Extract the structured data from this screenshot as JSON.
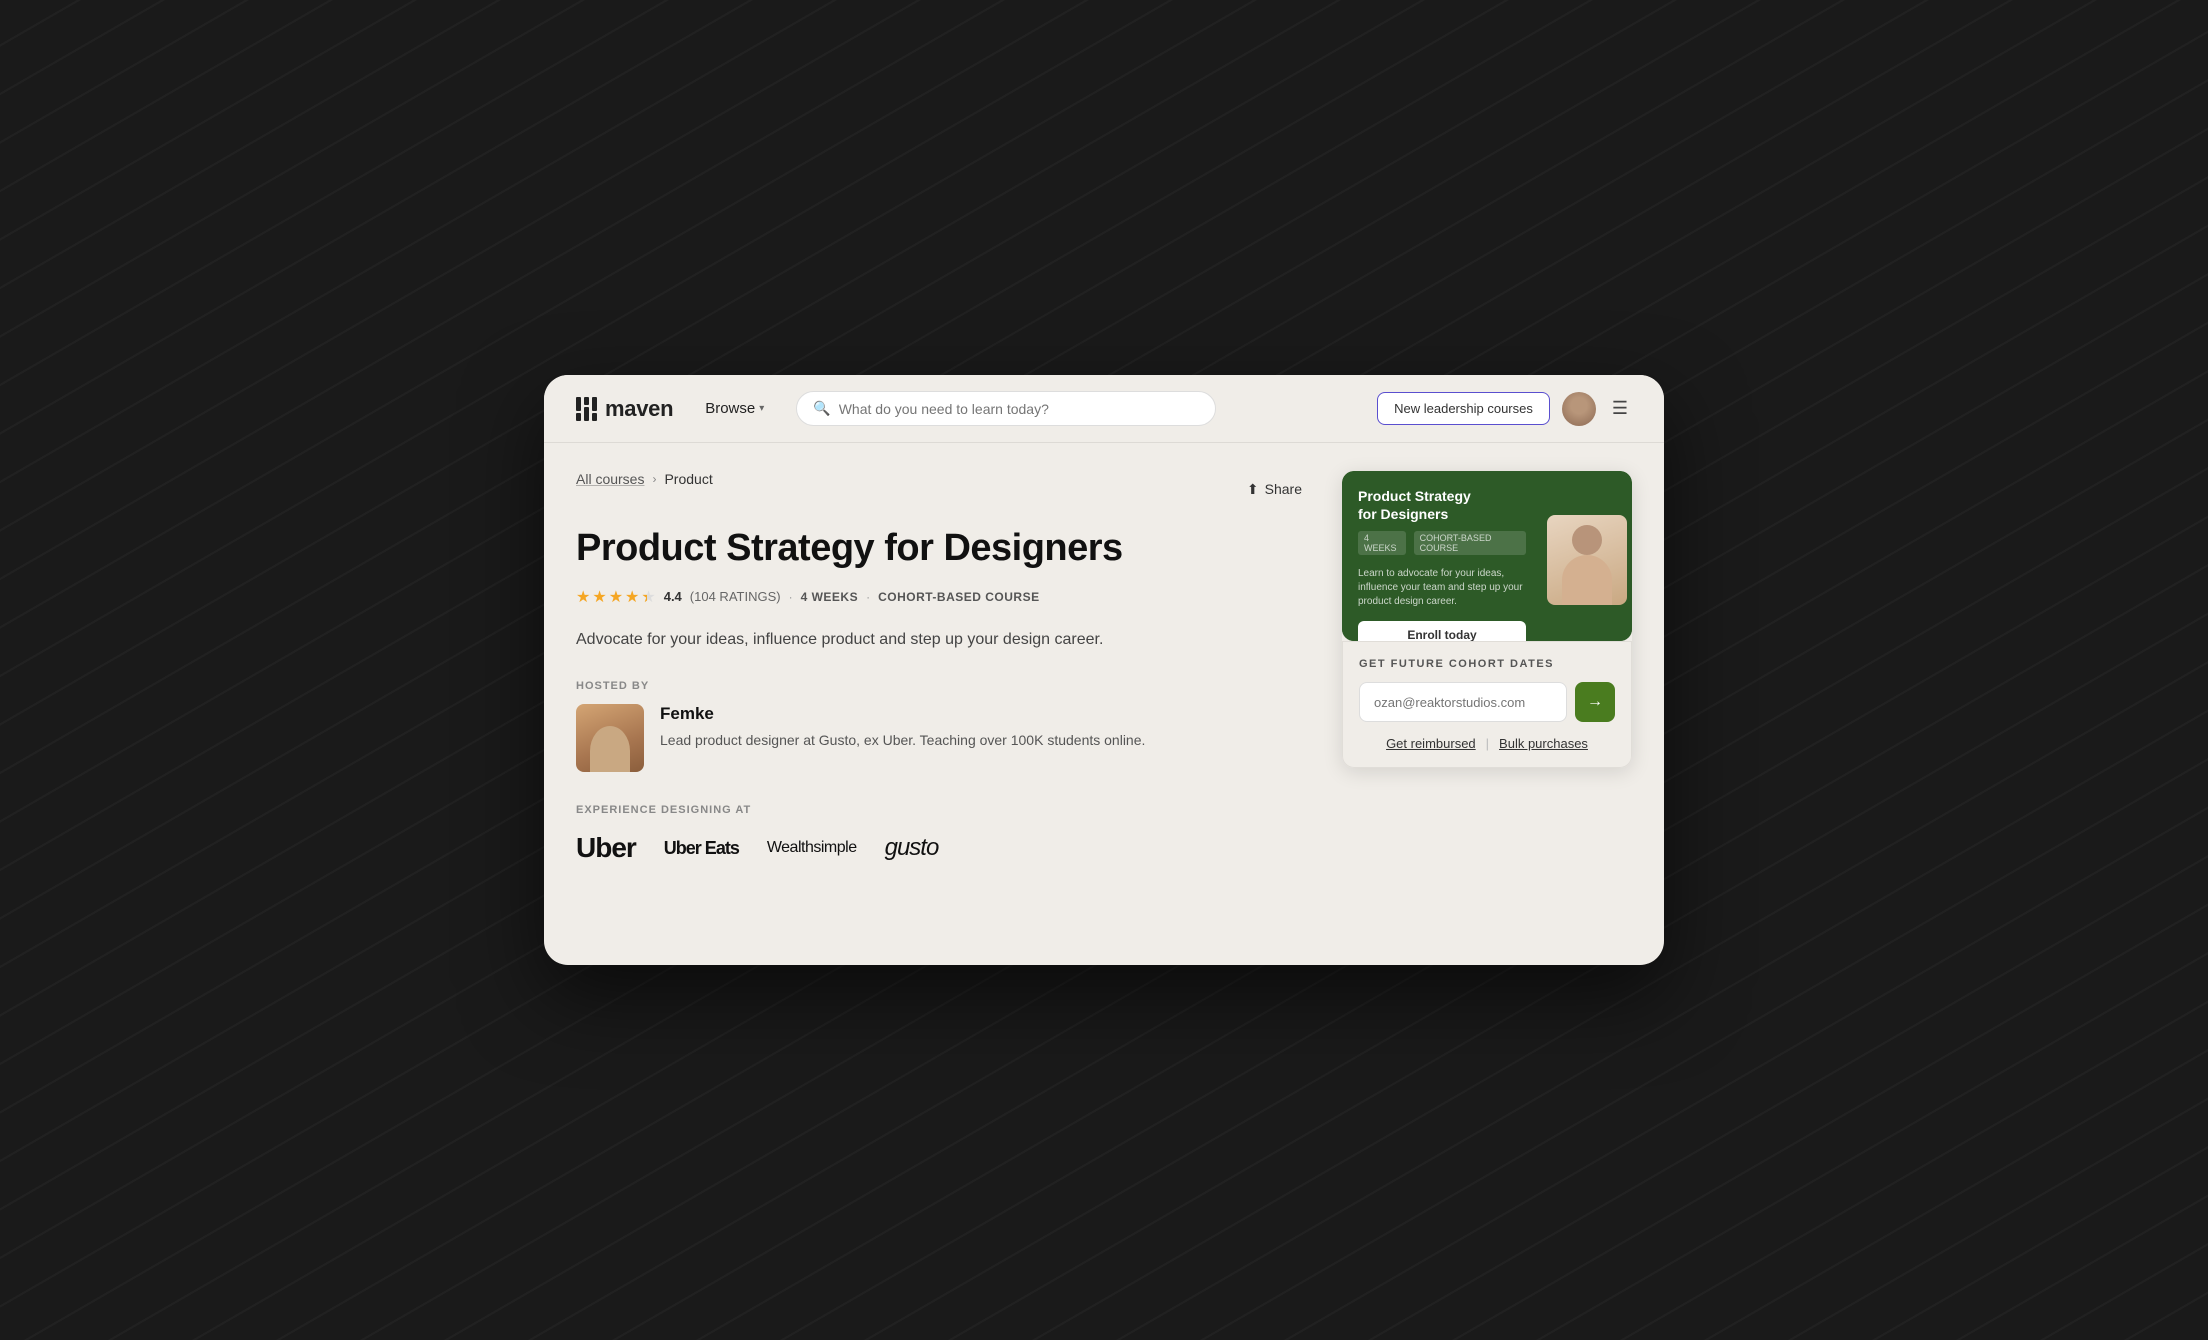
{
  "page": {
    "background": "#1a1a1a"
  },
  "navbar": {
    "logo_text": "maven",
    "browse_label": "Browse",
    "search_placeholder": "What do you need to learn today?",
    "new_courses_button": "New leadership courses",
    "menu_icon": "☰"
  },
  "breadcrumb": {
    "all_courses": "All courses",
    "current": "Product"
  },
  "share": {
    "label": "Share"
  },
  "course": {
    "title": "Product Strategy for Designers",
    "rating": "4.4",
    "rating_count": "(104 RATINGS)",
    "duration": "4 WEEKS",
    "type": "COHORT-BASED COURSE",
    "description": "Advocate for your ideas, influence product and step up your design career."
  },
  "host": {
    "label": "HOSTED BY",
    "name": "Femke",
    "bio": "Lead product designer at Gusto, ex Uber. Teaching over 100K students online."
  },
  "experience": {
    "label": "EXPERIENCE DESIGNING AT",
    "companies": [
      "Uber",
      "Uber Eats",
      "Wealthsimple",
      "gusto"
    ]
  },
  "video_card": {
    "title": "Product Strategy\nfor Designers",
    "meta1": "4 WEEKS",
    "meta2": "COHORT-BASED COURSE",
    "description": "Learn to advocate for your ideas, influence your team and step up your product design career.",
    "enroll_label": "Enroll today"
  },
  "cohort_form": {
    "label": "GET FUTURE COHORT DATES",
    "email_placeholder": "ozan@reaktorstudios.com",
    "reimburse_label": "Get reimbursed",
    "bulk_label": "Bulk purchases"
  }
}
